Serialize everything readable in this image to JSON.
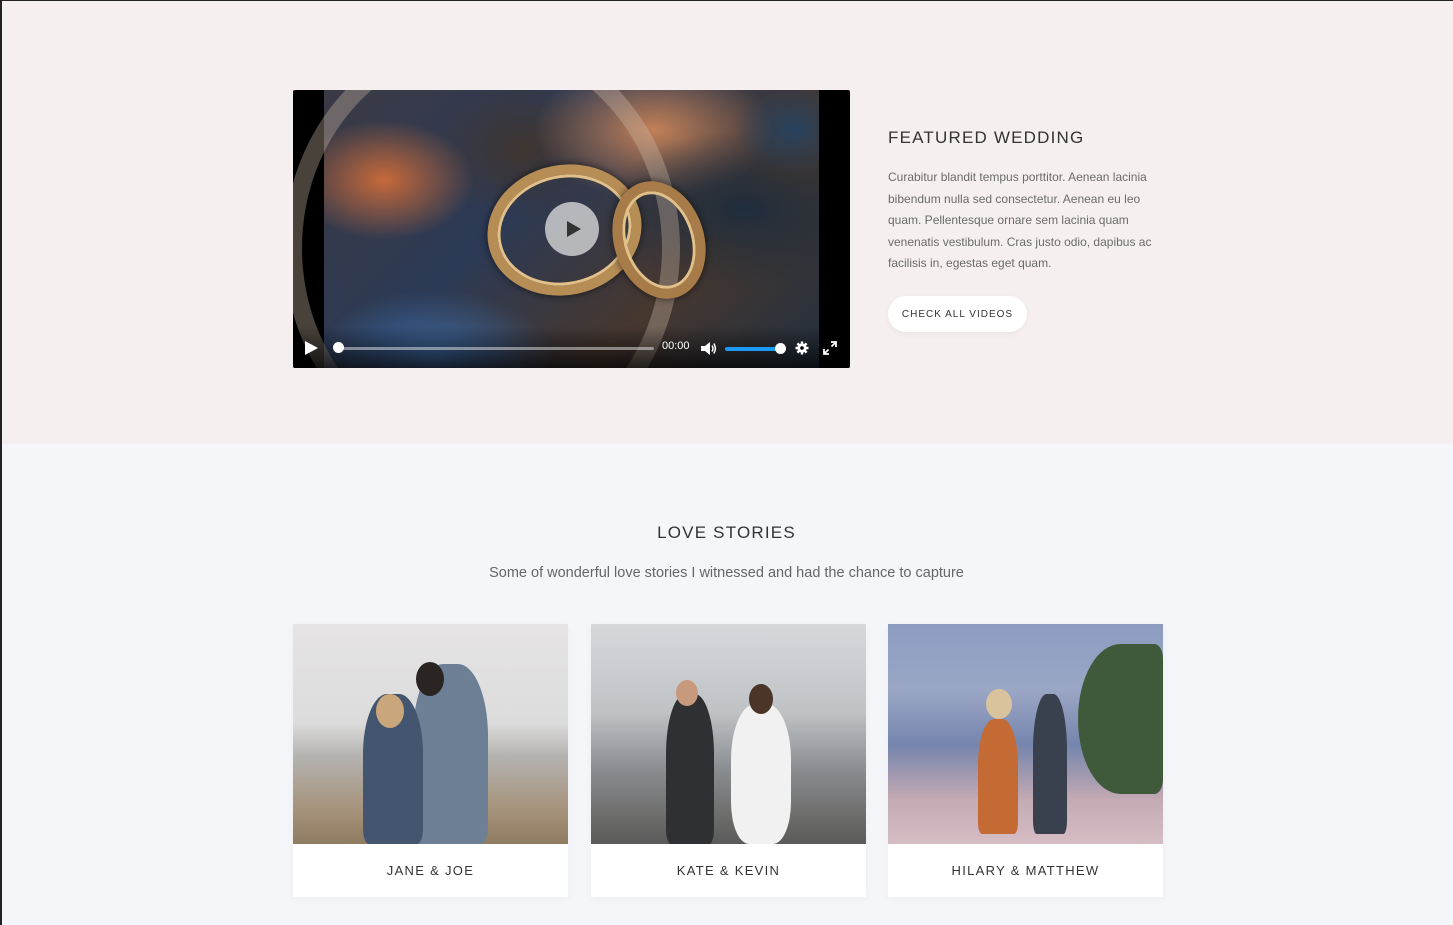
{
  "featured": {
    "title": "FEATURED WEDDING",
    "text": "Curabitur blandit tempus porttitor. Aenean lacinia bibendum nulla sed consectetur. Aenean eu leo quam. Pellentesque ornare sem lacinia quam venenatis vestibulum. Cras justo odio, dapibus ac facilisis in, egestas eget quam.",
    "button_label": "CHECK ALL VIDEOS",
    "video": {
      "time": "00:00",
      "progress": 0.0,
      "volume": 1.0,
      "icons": [
        "play-icon",
        "volume-icon",
        "gear-icon",
        "fullscreen-icon"
      ]
    }
  },
  "love_stories": {
    "title": "LOVE STORIES",
    "subtitle": "Some of wonderful love stories I witnessed and had the chance to capture",
    "cards": [
      {
        "name": "JANE & JOE"
      },
      {
        "name": "KATE & KEVIN"
      },
      {
        "name": "HILARY & MATTHEW"
      }
    ]
  },
  "colors": {
    "featured_bg": "#f6efef",
    "page_bg": "#f5f6fa",
    "volume_accent": "#1a9af5"
  }
}
